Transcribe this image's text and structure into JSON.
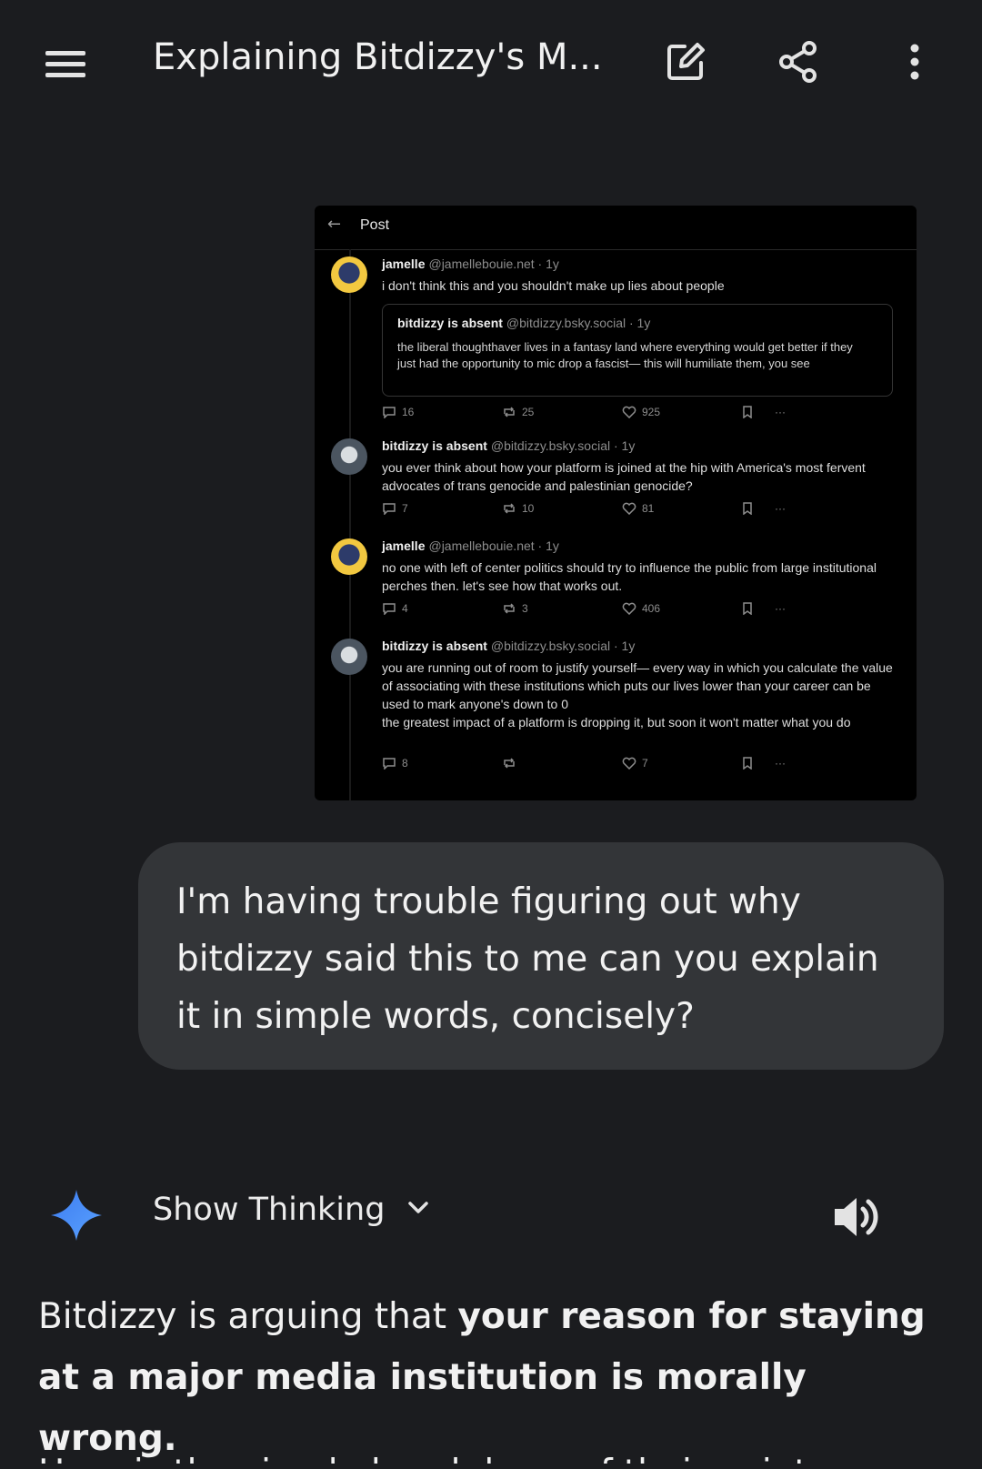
{
  "header": {
    "title": "Explaining Bitdizzy's M...",
    "icons": [
      "menu-icon",
      "edit-icon",
      "share-icon",
      "more-vert-icon"
    ]
  },
  "screenshot": {
    "header_label": "Post",
    "back_glyph": "←",
    "posts": [
      {
        "name": "jamelle",
        "handle": "@jamellebouie.net · 1y",
        "text": "i don't think this and you shouldn't make up lies about people",
        "quote": {
          "name": "bitdizzy is absent",
          "handle": "@bitdizzy.bsky.social · 1y",
          "text": "the liberal thoughthaver lives in a fantasy land where everything would get better if they just had the opportunity to mic drop a fascist— this will humiliate them, you see"
        },
        "replies": "16",
        "reposts": "25",
        "likes": "925"
      },
      {
        "name": "bitdizzy is absent",
        "handle": "@bitdizzy.bsky.social · 1y",
        "text": "you ever think about how your platform is joined at the hip with America's most fervent advocates of trans genocide and palestinian genocide?",
        "replies": "7",
        "reposts": "10",
        "likes": "81"
      },
      {
        "name": "jamelle",
        "handle": "@jamellebouie.net · 1y",
        "text": "no one with left of center politics should try to influence the public from large institutional perches then. let's see how that works out.",
        "replies": "4",
        "reposts": "3",
        "likes": "406"
      },
      {
        "name": "bitdizzy is absent",
        "handle": "@bitdizzy.bsky.social · 1y",
        "text": "you are running out of room to justify yourself— every way in which you calculate the value of associating with these institutions which puts our lives lower than your career can be used to mark anyone's down to 0",
        "text2": "the greatest impact of a platform is dropping it, but soon it won't matter what you do",
        "replies": "8",
        "reposts": "",
        "likes": "7"
      }
    ],
    "more_glyph": "···"
  },
  "user_message": "I'm having trouble figuring out why bitdizzy said this to me can you explain it in simple words, concisely?",
  "assistant": {
    "thinking_label": "Show Thinking",
    "answer_plain": "Bitdizzy is arguing that ",
    "answer_bold": "your reason for staying at a major media institution is morally wrong.",
    "answer_next": "Here is the simple breakdown of their point:"
  },
  "colors": {
    "background": "#1b1c1f",
    "bubble": "#333538",
    "spark": "#4c8df6"
  }
}
